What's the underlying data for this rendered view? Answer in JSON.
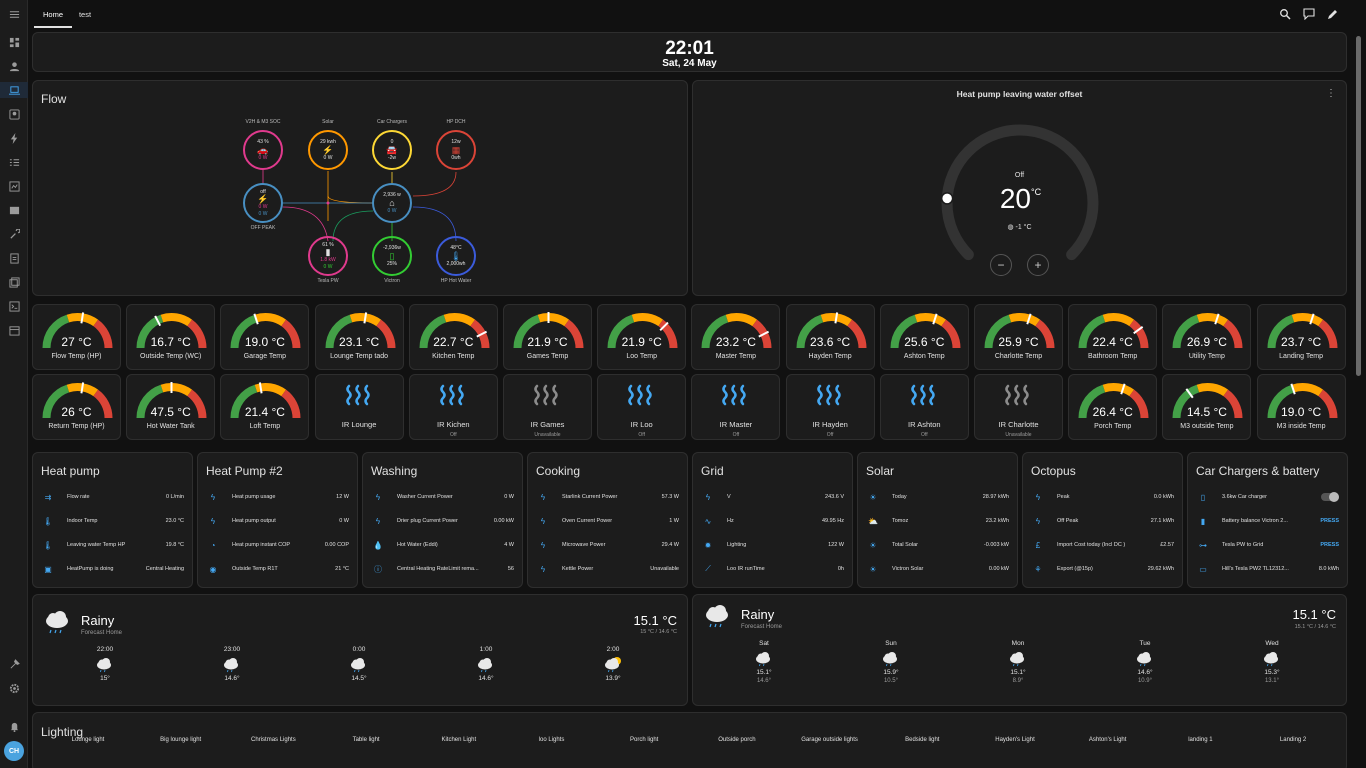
{
  "tabs": {
    "home": "Home",
    "test": "test"
  },
  "clock": {
    "time": "22:01",
    "date": "Sat, 24 May"
  },
  "flow": {
    "title": "Flow",
    "nodes": {
      "v2h": {
        "label": "V2H & M3 SOC",
        "value": "43 %",
        "sub": "0 W"
      },
      "solar": {
        "label": "Solar",
        "value": "29 kwh",
        "sub": "0 W"
      },
      "chargers": {
        "label": "Car Chargers",
        "value": "0",
        "sub": "-2w"
      },
      "hpdch": {
        "label": "HP DCH",
        "value": "12w",
        "sub": "0wh"
      },
      "grid": {
        "value": "off",
        "in": "0 W",
        "out": "0 W",
        "label": "OFF PEAK"
      },
      "home": {
        "value": "2,936 w",
        "sub": "0 W"
      },
      "tesla": {
        "value": "61 %",
        "sub1": "1.8 kW",
        "sub2": "0 W",
        "label": "Tesla PW"
      },
      "victron": {
        "value": "-2,936w",
        "sub": "25%",
        "label": "Victron"
      },
      "hotwater": {
        "value": "48°C",
        "sub": "2,000wh",
        "label": "HP Hot Water"
      }
    }
  },
  "thermostat": {
    "title": "Heat pump leaving water offset",
    "mode": "Off",
    "value": "20",
    "unit": "°C",
    "current": "-1 °C",
    "level": 0.18
  },
  "gauges_row1": [
    {
      "value": "27 °C",
      "name": "Flow Temp (HP)",
      "level": 0.55
    },
    {
      "value": "16.7 °C",
      "name": "Outside Temp (WC)",
      "level": 0.35
    },
    {
      "value": "19.0 °C",
      "name": "Garage Temp",
      "level": 0.4
    },
    {
      "value": "23.1 °C",
      "name": "Lounge Temp tado",
      "level": 0.55
    },
    {
      "value": "22.7 °C",
      "name": "Kitchen Temp",
      "level": 0.85
    },
    {
      "value": "21.9 °C",
      "name": "Games Temp",
      "level": 0.5
    },
    {
      "value": "21.9 °C",
      "name": "Loo Temp",
      "level": 0.75
    },
    {
      "value": "23.2 °C",
      "name": "Master Temp",
      "level": 0.85
    },
    {
      "value": "23.6 °C",
      "name": "Hayden Temp",
      "level": 0.55
    },
    {
      "value": "25.6 °C",
      "name": "Ashton Temp",
      "level": 0.6
    },
    {
      "value": "25.9 °C",
      "name": "Charlotte Temp",
      "level": 0.6
    },
    {
      "value": "22.4 °C",
      "name": "Bathroom Temp",
      "level": 0.8
    },
    {
      "value": "26.9 °C",
      "name": "Utility Temp",
      "level": 0.6
    },
    {
      "value": "23.7 °C",
      "name": "Landing Temp",
      "level": 0.6
    }
  ],
  "row2": [
    {
      "kind": "gauge",
      "value": "26 °C",
      "name": "Return Temp (HP)",
      "level": 0.55
    },
    {
      "kind": "gauge",
      "value": "47.5 °C",
      "name": "Hot Water Tank",
      "level": 0.5
    },
    {
      "kind": "gauge",
      "value": "21.4 °C",
      "name": "Loft Temp",
      "level": 0.45
    },
    {
      "kind": "ir",
      "name": "IR Lounge",
      "state": "",
      "active": true
    },
    {
      "kind": "ir",
      "name": "IR Kichen",
      "state": "Off",
      "active": true
    },
    {
      "kind": "ir",
      "name": "IR Games",
      "state": "Unavailable",
      "active": false
    },
    {
      "kind": "ir",
      "name": "IR Loo",
      "state": "Off",
      "active": true
    },
    {
      "kind": "ir",
      "name": "IR Master",
      "state": "Off",
      "active": true
    },
    {
      "kind": "ir",
      "name": "IR Hayden",
      "state": "Off",
      "active": true
    },
    {
      "kind": "ir",
      "name": "IR Ashton",
      "state": "Off",
      "active": true
    },
    {
      "kind": "ir",
      "name": "IR Charlotte",
      "state": "Unavailable",
      "active": false
    },
    {
      "kind": "gauge",
      "value": "26.4 °C",
      "name": "Porch Temp",
      "level": 0.6
    },
    {
      "kind": "gauge",
      "value": "14.5 °C",
      "name": "M3 outside Temp",
      "level": 0.3
    },
    {
      "kind": "gauge",
      "value": "19.0 °C",
      "name": "M3 inside Temp",
      "level": 0.4
    }
  ],
  "entity_cards": [
    {
      "title": "Heat pump",
      "rows": [
        {
          "icon": "⇉",
          "name": "Flow rate",
          "value": "0 L/min"
        },
        {
          "icon": "🌡",
          "name": "Indoor Temp",
          "value": "23.0 °C"
        },
        {
          "icon": "🌡",
          "name": "Leaving water Temp HP",
          "value": "19.8 °C"
        },
        {
          "icon": "▣",
          "name": "HeatPump is doing",
          "value": "Central Heating"
        }
      ]
    },
    {
      "title": "Heat Pump #2",
      "rows": [
        {
          "icon": "ϟ",
          "name": "Heat pump usage",
          "value": "12 W"
        },
        {
          "icon": "ϟ",
          "name": "Heat pump output",
          "value": "0 W"
        },
        {
          "icon": "◔",
          "name": "Heat pump instant COP",
          "value": "0.00 COP"
        },
        {
          "icon": "◉",
          "name": "Outside Temp R1T",
          "value": "21 °C"
        }
      ]
    },
    {
      "title": "Washing",
      "rows": [
        {
          "icon": "ϟ",
          "name": "Washer Current Power",
          "value": "0 W"
        },
        {
          "icon": "ϟ",
          "name": "Drier plug Current Power",
          "value": "0.00 kW"
        },
        {
          "icon": "💧",
          "name": "Hot Water (Eddi)",
          "value": "4 W"
        },
        {
          "icon": "ⓘ",
          "name": "Central Heating RateLimit rema...",
          "value": "56"
        }
      ]
    },
    {
      "title": "Cooking",
      "rows": [
        {
          "icon": "ϟ",
          "name": "Starlink Current Power",
          "value": "57.3 W"
        },
        {
          "icon": "ϟ",
          "name": "Oven Current Power",
          "value": "1 W"
        },
        {
          "icon": "ϟ",
          "name": "Microwave Power",
          "value": "29.4 W"
        },
        {
          "icon": "ϟ",
          "name": "Kettle Power",
          "value": "Unavailable"
        }
      ]
    },
    {
      "title": "Grid",
      "rows": [
        {
          "icon": "ϟ",
          "name": "V",
          "value": "243.6 V"
        },
        {
          "icon": "∿",
          "name": "Hz",
          "value": "49.95 Hz"
        },
        {
          "icon": "✹",
          "name": "Lighting",
          "value": "122 W"
        },
        {
          "icon": "⟋",
          "name": "Loo IR runTime",
          "value": "0h"
        }
      ]
    },
    {
      "title": "Solar",
      "rows": [
        {
          "icon": "☀",
          "name": "Today",
          "value": "28.97 kWh"
        },
        {
          "icon": "⛅",
          "name": "Tomoz",
          "value": "23.2 kWh"
        },
        {
          "icon": "☀",
          "name": "Total Solar",
          "value": "-0.003 kW"
        },
        {
          "icon": "☀",
          "name": "Victron Solar",
          "value": "0.00 kW"
        }
      ]
    },
    {
      "title": "Octopus",
      "rows": [
        {
          "icon": "ϟ",
          "name": "Peak",
          "value": "0.0 kWh"
        },
        {
          "icon": "ϟ",
          "name": "Off Peak",
          "value": "27.1 kWh"
        },
        {
          "icon": "£",
          "name": "Import Cost today (Incl DC )",
          "value": "£2.57"
        },
        {
          "icon": "⚘",
          "name": "Export (@15p)",
          "value": "29.62 kWh"
        }
      ]
    },
    {
      "title": "Car Chargers & battery",
      "rows": [
        {
          "icon": "▯",
          "name": "3.6kw Car charger",
          "value": "",
          "toggle": true
        },
        {
          "icon": "▮",
          "name": "Battery balance Victron 2...",
          "value": "PRESS",
          "press": true
        },
        {
          "icon": "⊶",
          "name": "Tesla PW to Grid",
          "value": "PRESS",
          "press": true
        },
        {
          "icon": "▭",
          "name": "Hill's Tesla PW2 TL12312...",
          "value": "8.0 kWh"
        }
      ]
    }
  ],
  "weather_hourly": {
    "condition": "Rainy",
    "source": "Forecast Home",
    "temp": "15.1 °C",
    "range": "15 °C / 14.6 °C",
    "forecast": [
      {
        "time": "22:00",
        "temp": "15°",
        "icon": "cloud"
      },
      {
        "time": "23:00",
        "temp": "14.6°",
        "icon": "cloud"
      },
      {
        "time": "0:00",
        "temp": "14.5°",
        "icon": "cloud"
      },
      {
        "time": "1:00",
        "temp": "14.6°",
        "icon": "cloud"
      },
      {
        "time": "2:00",
        "temp": "13.9°",
        "icon": "cloud-sun"
      }
    ]
  },
  "weather_daily": {
    "condition": "Rainy",
    "source": "Forecast Home",
    "temp": "15.1 °C",
    "range": "15.1 °C / 14.6 °C",
    "forecast": [
      {
        "day": "Sat",
        "hi": "15.1°",
        "lo": "14.6°"
      },
      {
        "day": "Sun",
        "hi": "15.9°",
        "lo": "10.5°"
      },
      {
        "day": "Mon",
        "hi": "15.1°",
        "lo": "8.9°"
      },
      {
        "day": "Tue",
        "hi": "14.6°",
        "lo": "10.9°"
      },
      {
        "day": "Wed",
        "hi": "15.3°",
        "lo": "13.1°"
      }
    ]
  },
  "lighting": {
    "title": "Lighting",
    "lights": [
      "Lounge light",
      "Big lounge light",
      "Christmas Lights",
      "Table light",
      "Kitchen Light",
      "loo Lights",
      "Porch light",
      "Outside porch",
      "Garage outside lights",
      "Bedside light",
      "Hayden's Light",
      "Ashton's Light",
      "landing 1",
      "Landing 2"
    ]
  },
  "user": {
    "initials": "CH"
  },
  "colors": {
    "accent": "#44a8f2",
    "green": "#43a047",
    "yellow": "#ffa600",
    "red": "#db4437"
  }
}
